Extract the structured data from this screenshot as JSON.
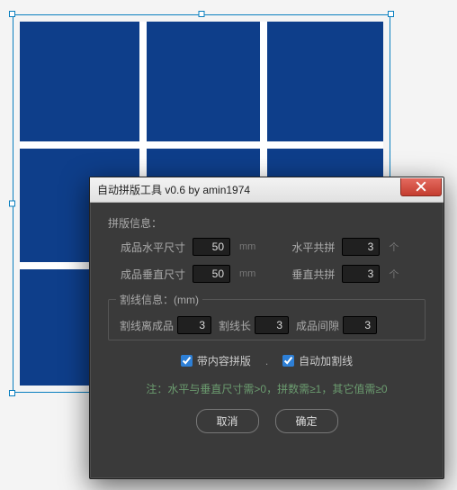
{
  "dialog": {
    "title": "自动拼版工具 v0.6   by amin1974",
    "section1_title": "拼版信息：",
    "h_size_label": "成品水平尺寸",
    "h_size_value": "50",
    "size_unit": "mm",
    "h_count_label": "水平共拼",
    "h_count_value": "3",
    "count_unit": "个",
    "v_size_label": "成品垂直尺寸",
    "v_size_value": "50",
    "v_count_label": "垂直共拼",
    "v_count_value": "3",
    "section2_title": "割线信息：(mm)",
    "cut_offset_label": "割线离成品",
    "cut_offset_value": "3",
    "cut_len_label": "割线长",
    "cut_len_value": "3",
    "gap_label": "成品间隙",
    "gap_value": "3",
    "check1_label": "带内容拼版",
    "check1_checked": true,
    "check2_label": "自动加割线",
    "check2_checked": true,
    "note": "注：水平与垂直尺寸需>0，拼数需≥1，其它值需≥0",
    "cancel": "取消",
    "ok": "确定"
  }
}
